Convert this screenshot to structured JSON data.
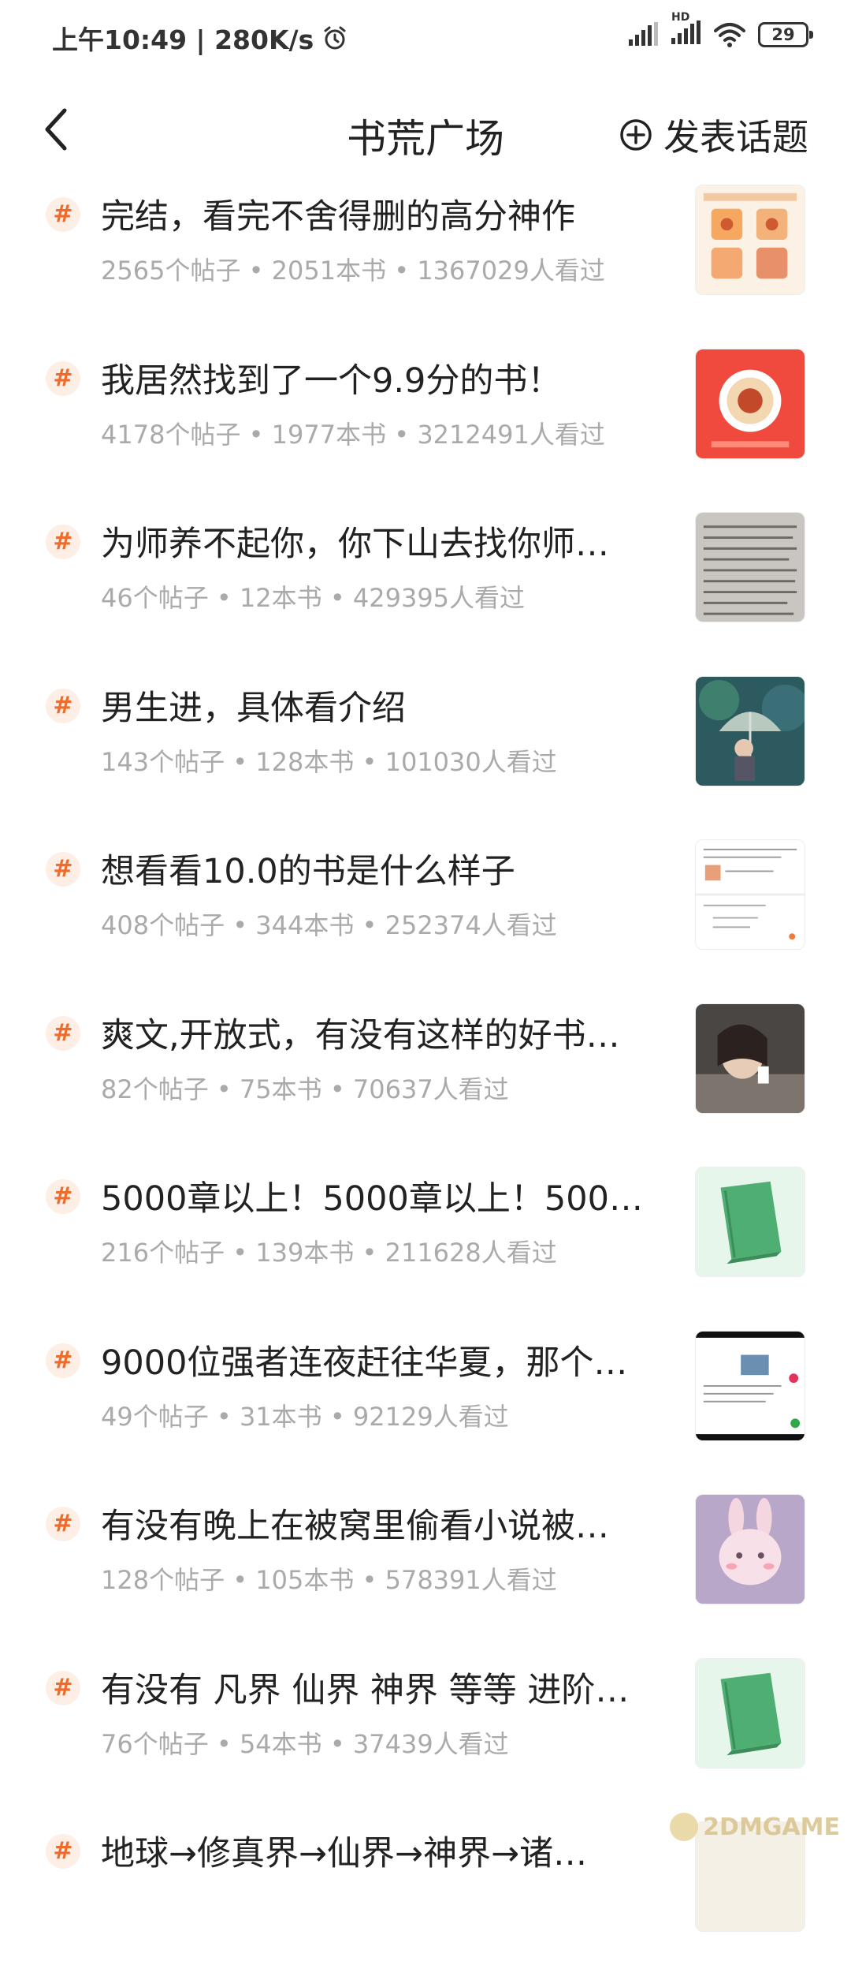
{
  "status_bar": {
    "time_speed": "上午10:49 | 280K/s",
    "network": "HD",
    "battery": "29"
  },
  "header": {
    "title": "书荒广场",
    "publish_label": "发表话题"
  },
  "topic_hash": "#",
  "topics": [
    {
      "title": "完结，看完不舍得删的高分神作",
      "stats": "2565个帖子 • 2051本书 • 1367029人看过"
    },
    {
      "title": "我居然找到了一个9.9分的书！",
      "stats": "4178个帖子 • 1977本书 • 3212491人看过"
    },
    {
      "title": "为师养不起你，你下山去找你师…",
      "stats": "46个帖子 • 12本书 • 429395人看过"
    },
    {
      "title": "男生进，具体看介绍",
      "stats": "143个帖子 • 128本书 • 101030人看过"
    },
    {
      "title": "想看看10.0的书是什么样子",
      "stats": "408个帖子 • 344本书 • 252374人看过"
    },
    {
      "title": "爽文,开放式，有没有这样的好书…",
      "stats": "82个帖子 • 75本书 • 70637人看过"
    },
    {
      "title": "5000章以上！5000章以上！5000…",
      "stats": "216个帖子 • 139本书 • 211628人看过"
    },
    {
      "title": "9000位强者连夜赶往华夏，那个…",
      "stats": "49个帖子 • 31本书 • 92129人看过"
    },
    {
      "title": "有没有晚上在被窝里偷看小说被…",
      "stats": "128个帖子 • 105本书 • 578391人看过"
    },
    {
      "title": "有没有 凡界 仙界 神界 等等 进阶…",
      "stats": "76个帖子 • 54本书 • 37439人看过"
    },
    {
      "title": "地球→修真界→仙界→神界→诸…",
      "stats": ""
    }
  ],
  "watermark": "2DMGAME"
}
